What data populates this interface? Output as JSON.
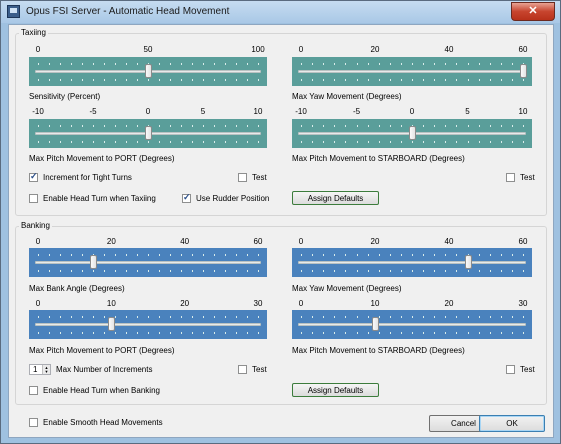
{
  "window": {
    "title": "Opus FSI Server - Automatic Head Movement",
    "close_glyph": "✕"
  },
  "colors": {
    "taxiing_slider": "#5a9e9a",
    "banking_slider": "#4a82bd",
    "titlebar": "#b4cfea",
    "window_bg": "#f0f0f0"
  },
  "taxiing": {
    "label": "Taxiing",
    "sliders": [
      {
        "caption": "Sensitivity (Percent)",
        "scale": [
          "0",
          "50",
          "100"
        ],
        "min": 0,
        "max": 100,
        "value": 50
      },
      {
        "caption": "Max Yaw Movement (Degrees)",
        "scale": [
          "0",
          "20",
          "40",
          "60"
        ],
        "min": 0,
        "max": 60,
        "value": 60
      },
      {
        "caption": "Max Pitch Movement to PORT (Degrees)",
        "scale": [
          "-10",
          "-5",
          "0",
          "5",
          "10"
        ],
        "min": -10,
        "max": 10,
        "value": 0
      },
      {
        "caption": "Max Pitch Movement to STARBOARD (Degrees)",
        "scale": [
          "-10",
          "-5",
          "0",
          "5",
          "10"
        ],
        "min": -10,
        "max": 10,
        "value": 0
      }
    ],
    "increment_tight_turns": {
      "label": "Increment for Tight Turns",
      "checked": true
    },
    "test_left": {
      "label": "Test",
      "checked": false
    },
    "test_right": {
      "label": "Test",
      "checked": false
    },
    "enable_head_turn": {
      "label": "Enable Head Turn when Taxiing",
      "checked": false
    },
    "use_rudder": {
      "label": "Use Rudder Position",
      "checked": true
    },
    "assign_defaults": "Assign Defaults"
  },
  "banking": {
    "label": "Banking",
    "sliders": [
      {
        "caption": "Max Bank Angle (Degrees)",
        "scale": [
          "0",
          "20",
          "40",
          "60"
        ],
        "min": 0,
        "max": 60,
        "value": 15
      },
      {
        "caption": "Max Yaw Movement (Degrees)",
        "scale": [
          "0",
          "20",
          "40",
          "60"
        ],
        "min": 0,
        "max": 60,
        "value": 45
      },
      {
        "caption": "Max Pitch Movement to PORT (Degrees)",
        "scale": [
          "0",
          "10",
          "20",
          "30"
        ],
        "min": 0,
        "max": 30,
        "value": 10
      },
      {
        "caption": "Max Pitch Movement to STARBOARD (Degrees)",
        "scale": [
          "0",
          "10",
          "20",
          "30"
        ],
        "min": 0,
        "max": 30,
        "value": 10
      }
    ],
    "max_increments": {
      "label": "Max Number of Increments",
      "value": "1"
    },
    "test_left": {
      "label": "Test",
      "checked": false
    },
    "test_right": {
      "label": "Test",
      "checked": false
    },
    "enable_head_turn": {
      "label": "Enable Head Turn when Banking",
      "checked": false
    },
    "assign_defaults": "Assign Defaults"
  },
  "footer": {
    "smooth": {
      "label": "Enable Smooth Head Movements",
      "checked": false
    },
    "cancel": "Cancel",
    "ok": "OK"
  }
}
